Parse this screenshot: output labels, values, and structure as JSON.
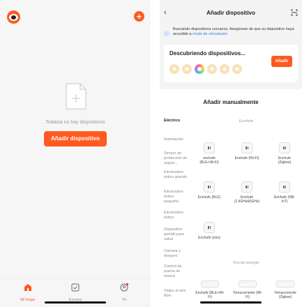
{
  "left": {
    "empty_text": "Todavía no hay dispositivos",
    "add_device_label": "Añadir dispositivo",
    "nav": [
      {
        "label": "Mi hogar",
        "active": true
      },
      {
        "label": "Escena",
        "active": false
      },
      {
        "label": "Yo",
        "active": false
      }
    ]
  },
  "right": {
    "title": "Añadir dispositivo",
    "search_text": "Buscando dispositivos cercanos. Asegúrese de que su dispositivo haya accedido a",
    "search_link": "modo de vinculación",
    "discovering_title": "Descubriendo dispositivos...",
    "add_label": "Añadir",
    "manual_title": "Añadir manualmente",
    "categories": [
      "Eléctrico",
      "Iluminación",
      "Sensor de protección de seguri...",
      "Electrodom éstico grande",
      "Electrodom éstico pequeño",
      "Electrodom éstico",
      "Dispositivo portátil para salud",
      "Cámara y bloqueo",
      "Control de puerta de enlace",
      "Viajes al aire libre"
    ],
    "section_enchufe": "Enchufe",
    "section_tira": "Tira de energía",
    "plugs": [
      "enchufe (BLE+Wi-Fi)",
      "Enchufe (Wi-Fi)",
      "Enchufe (Zigbee)",
      "Enchufe (BLE)",
      "Enchufe (2.4GHz&5GHz)",
      "Enchufe (NB-IoT)",
      "Enchufe (otro)"
    ],
    "strips": [
      "Enchufe (BLE+Wi-Fi)",
      "Tomacorriente (Wi-Fi)",
      "Tomacorriente (Zigbee)"
    ]
  },
  "colors": {
    "accent": "#ff5a1f",
    "link": "#2a7be6"
  }
}
